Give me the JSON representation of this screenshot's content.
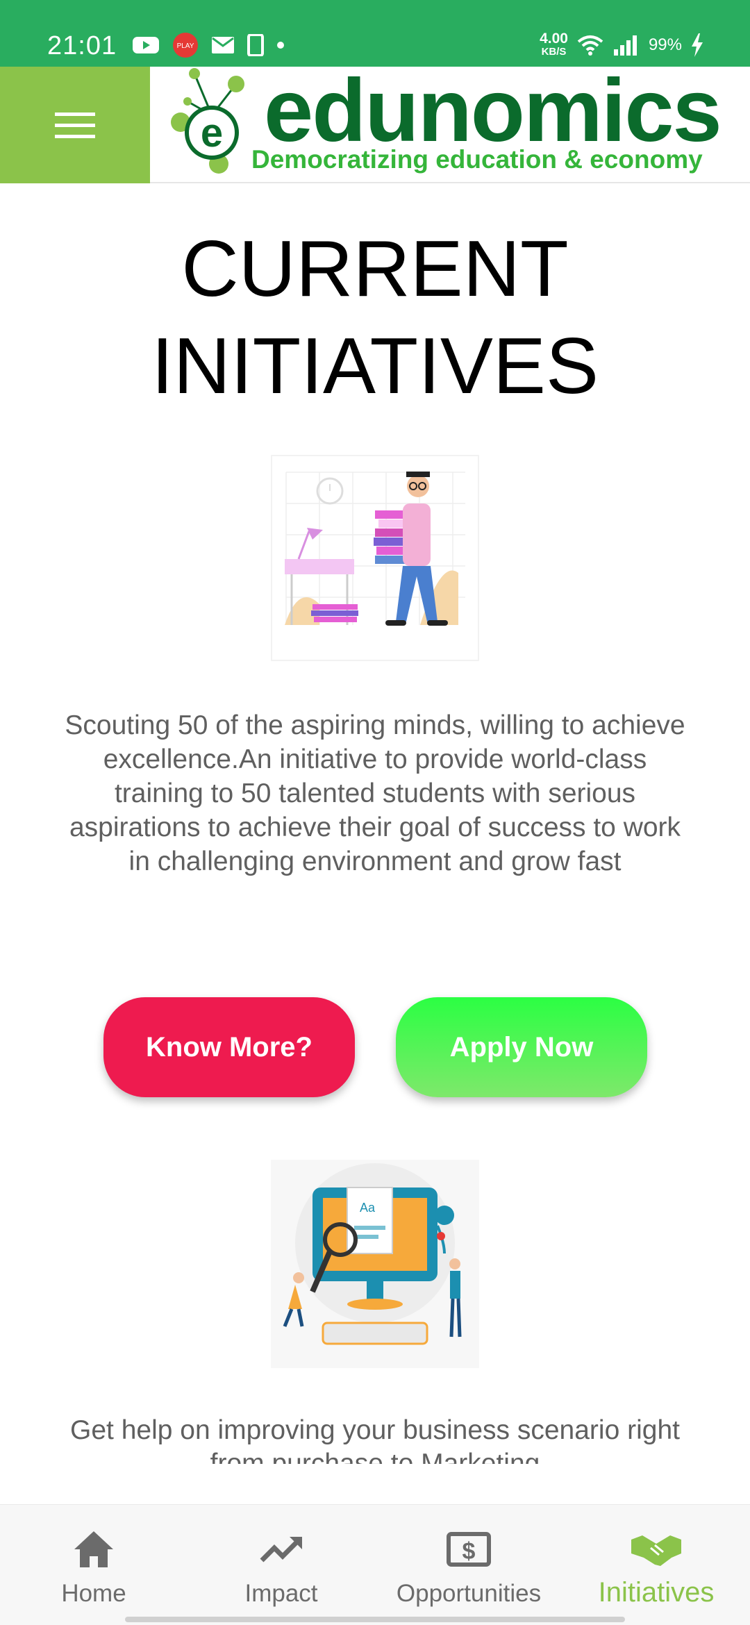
{
  "status_bar": {
    "time": "21:01",
    "network_speed": "4.00",
    "network_speed_unit": "KB/S",
    "battery_percent": "99%",
    "icons_left": [
      "youtube-icon",
      "play-badge-icon",
      "mail-icon",
      "phone-icon",
      "dot-icon"
    ],
    "icons_right": [
      "wifi-icon",
      "signal-icon",
      "charging-icon"
    ]
  },
  "header": {
    "logo_text": "edunomics",
    "logo_tagline": "Democratizing education & economy",
    "menu_icon": "hamburger-icon"
  },
  "main": {
    "title_line1": "CURRENT",
    "title_line2": "INITIATIVES",
    "initiative_1": {
      "description": "Scouting 50 of the aspiring minds, willing to achieve excellence.An initiative to provide world-class training to 50 talented students with serious aspirations to achieve their goal of success to work in challenging environment and grow fast",
      "know_more_label": "Know More?",
      "apply_label": "Apply Now"
    },
    "initiative_2": {
      "description": "Get help on improving your business scenario right from purchase to Marketing"
    }
  },
  "bottom_nav": {
    "items": [
      {
        "label": "Home",
        "icon": "home-icon"
      },
      {
        "label": "Impact",
        "icon": "trending-up-icon"
      },
      {
        "label": "Opportunities",
        "icon": "dollar-icon"
      },
      {
        "label": "Initiatives",
        "icon": "handshake-icon",
        "active": true
      }
    ]
  },
  "colors": {
    "status_bar": "#29ad5f",
    "menu_bg": "#8bc34a",
    "know_more": "#ee1b4f",
    "apply_now": "#2bff43",
    "active_nav": "#8bc34a"
  }
}
